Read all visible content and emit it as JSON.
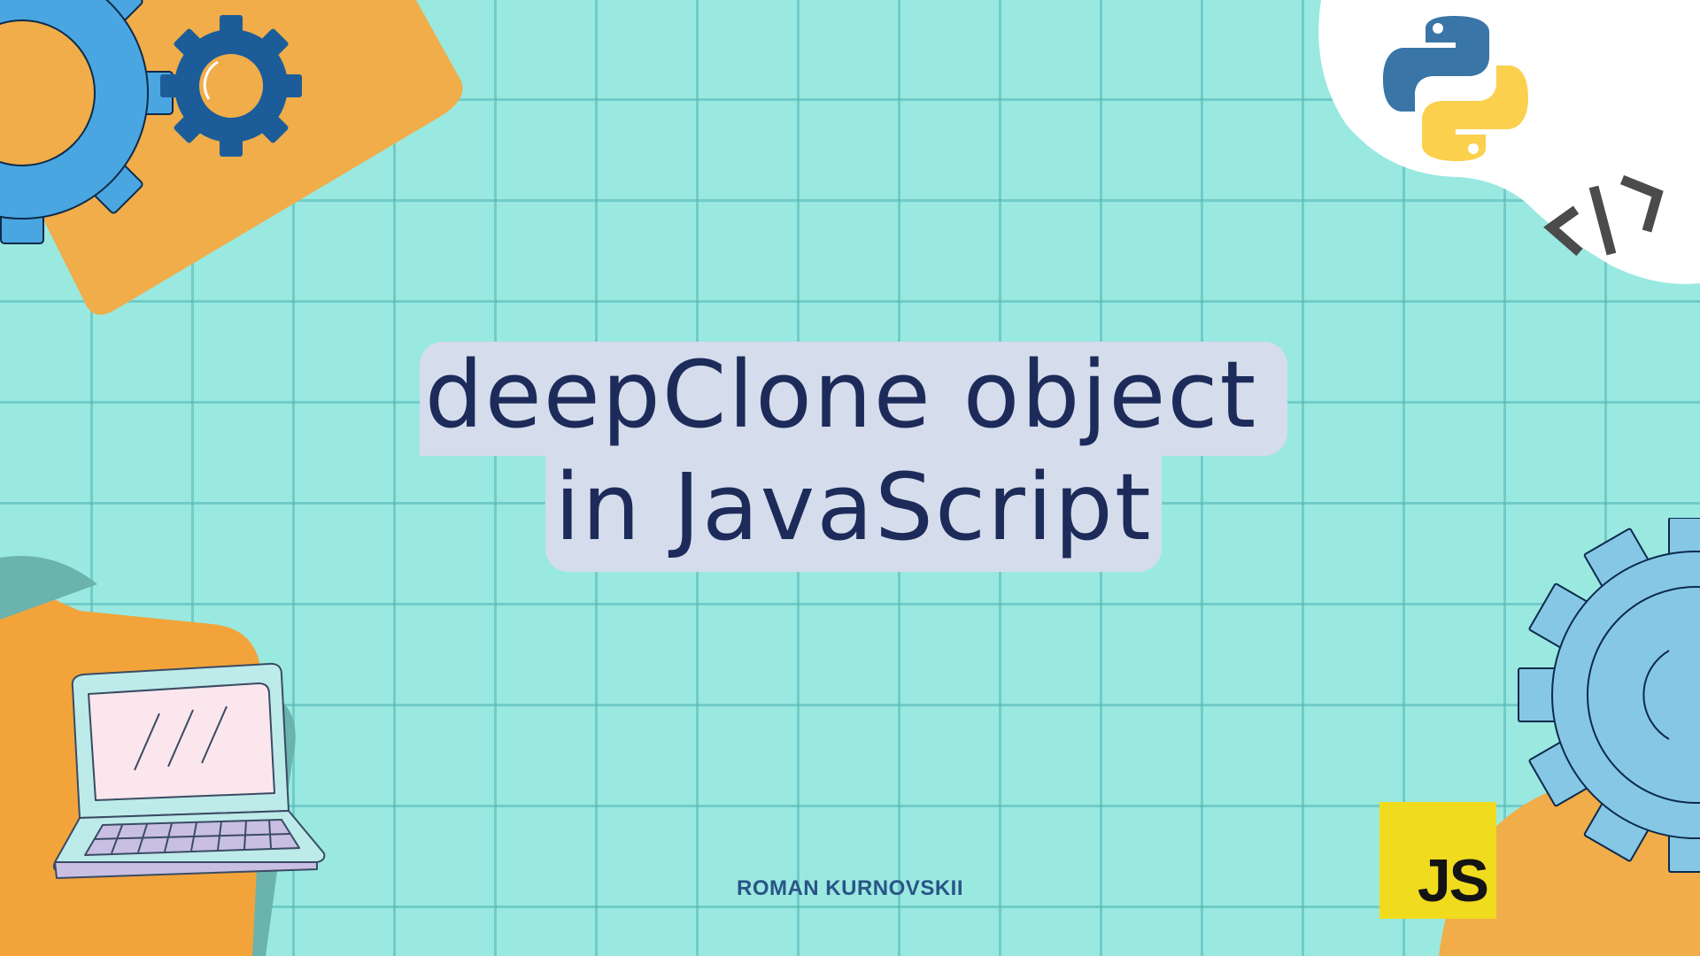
{
  "title": {
    "line1": "deepClone object",
    "line2": "in JavaScript"
  },
  "author": "ROMAN KURNOVSKII",
  "badges": {
    "js_label": "JS",
    "code_symbol": "</>"
  },
  "icons": [
    "gear-icon",
    "python-logo-icon",
    "code-tag-icon",
    "laptop-icon",
    "js-logo-icon"
  ],
  "colors": {
    "background": "#99e9e1",
    "grid": "#50b4b4",
    "title_bg": "#d5dceb",
    "title_text": "#1c2b5a",
    "orange": "#f2a43a",
    "gear_blue": "#4aa6e0",
    "gear_dark_blue": "#1c5d99",
    "js_yellow": "#f0db1f"
  }
}
